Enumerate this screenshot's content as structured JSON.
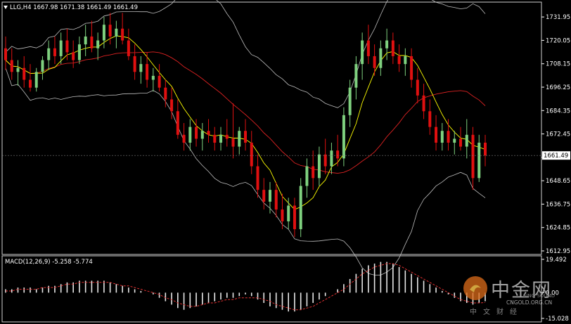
{
  "window": {
    "symbol": "LLG,H4",
    "open": "1667.98",
    "high": "1671.38",
    "low": "1661.49",
    "close": "1661.49"
  },
  "price_axis": {
    "ticks": [
      "1731.95",
      "1720.05",
      "1708.15",
      "1696.25",
      "1684.35",
      "1672.45",
      "1660.55",
      "1648.65",
      "1636.75",
      "1624.85",
      "1612.95"
    ],
    "current_price": "1661.49"
  },
  "macd": {
    "label": "MACD(12,26,9)",
    "macd_value": "-5.258",
    "signal_value": "-5.774",
    "axis_top": "19.492",
    "axis_zero": "0.00",
    "axis_bottom": "-15.028"
  },
  "watermark": {
    "brand": "中金网",
    "url": "CNGOLD.ORG.CN",
    "tagline": "中文财经",
    "sub": "SINO SOUND"
  },
  "colors": {
    "background": "#000000",
    "bull": "#7fd17f",
    "bear": "#e01010",
    "ma": "#ffff00",
    "bands": "#bdbdbd",
    "signal": "#e03030",
    "histogram": "#e8e8e8"
  },
  "chart_data": {
    "type": "candlestick",
    "title": "",
    "ylim": [
      1612.95,
      1737.0
    ],
    "candles": [
      {
        "o": 1716,
        "h": 1722,
        "l": 1705,
        "c": 1710
      },
      {
        "o": 1710,
        "h": 1716,
        "l": 1700,
        "c": 1704
      },
      {
        "o": 1704,
        "h": 1710,
        "l": 1697,
        "c": 1706
      },
      {
        "o": 1706,
        "h": 1712,
        "l": 1696,
        "c": 1700
      },
      {
        "o": 1700,
        "h": 1708,
        "l": 1694,
        "c": 1696
      },
      {
        "o": 1696,
        "h": 1706,
        "l": 1694,
        "c": 1704
      },
      {
        "o": 1704,
        "h": 1712,
        "l": 1700,
        "c": 1710
      },
      {
        "o": 1710,
        "h": 1720,
        "l": 1705,
        "c": 1716
      },
      {
        "o": 1716,
        "h": 1722,
        "l": 1708,
        "c": 1712
      },
      {
        "o": 1712,
        "h": 1724,
        "l": 1708,
        "c": 1720
      },
      {
        "o": 1720,
        "h": 1726,
        "l": 1710,
        "c": 1714
      },
      {
        "o": 1714,
        "h": 1720,
        "l": 1706,
        "c": 1710
      },
      {
        "o": 1710,
        "h": 1722,
        "l": 1708,
        "c": 1718
      },
      {
        "o": 1718,
        "h": 1728,
        "l": 1712,
        "c": 1722
      },
      {
        "o": 1722,
        "h": 1730,
        "l": 1714,
        "c": 1716
      },
      {
        "o": 1716,
        "h": 1724,
        "l": 1710,
        "c": 1720
      },
      {
        "o": 1720,
        "h": 1732,
        "l": 1716,
        "c": 1728
      },
      {
        "o": 1728,
        "h": 1734,
        "l": 1718,
        "c": 1722
      },
      {
        "o": 1722,
        "h": 1730,
        "l": 1716,
        "c": 1726
      },
      {
        "o": 1726,
        "h": 1734,
        "l": 1718,
        "c": 1720
      },
      {
        "o": 1720,
        "h": 1726,
        "l": 1710,
        "c": 1712
      },
      {
        "o": 1712,
        "h": 1718,
        "l": 1700,
        "c": 1704
      },
      {
        "o": 1704,
        "h": 1712,
        "l": 1698,
        "c": 1708
      },
      {
        "o": 1708,
        "h": 1714,
        "l": 1696,
        "c": 1700
      },
      {
        "o": 1700,
        "h": 1706,
        "l": 1694,
        "c": 1702
      },
      {
        "o": 1702,
        "h": 1708,
        "l": 1694,
        "c": 1696
      },
      {
        "o": 1696,
        "h": 1700,
        "l": 1686,
        "c": 1690
      },
      {
        "o": 1690,
        "h": 1696,
        "l": 1680,
        "c": 1684
      },
      {
        "o": 1684,
        "h": 1690,
        "l": 1670,
        "c": 1672
      },
      {
        "o": 1672,
        "h": 1678,
        "l": 1664,
        "c": 1668
      },
      {
        "o": 1668,
        "h": 1680,
        "l": 1664,
        "c": 1676
      },
      {
        "o": 1676,
        "h": 1680,
        "l": 1666,
        "c": 1670
      },
      {
        "o": 1670,
        "h": 1678,
        "l": 1664,
        "c": 1674
      },
      {
        "o": 1674,
        "h": 1680,
        "l": 1668,
        "c": 1672
      },
      {
        "o": 1672,
        "h": 1676,
        "l": 1664,
        "c": 1668
      },
      {
        "o": 1668,
        "h": 1676,
        "l": 1664,
        "c": 1672
      },
      {
        "o": 1672,
        "h": 1680,
        "l": 1666,
        "c": 1670
      },
      {
        "o": 1670,
        "h": 1688,
        "l": 1660,
        "c": 1666
      },
      {
        "o": 1666,
        "h": 1676,
        "l": 1662,
        "c": 1674
      },
      {
        "o": 1674,
        "h": 1680,
        "l": 1664,
        "c": 1668
      },
      {
        "o": 1668,
        "h": 1674,
        "l": 1652,
        "c": 1656
      },
      {
        "o": 1656,
        "h": 1662,
        "l": 1640,
        "c": 1644
      },
      {
        "o": 1644,
        "h": 1650,
        "l": 1634,
        "c": 1638
      },
      {
        "o": 1638,
        "h": 1648,
        "l": 1632,
        "c": 1644
      },
      {
        "o": 1644,
        "h": 1648,
        "l": 1630,
        "c": 1634
      },
      {
        "o": 1634,
        "h": 1642,
        "l": 1624,
        "c": 1628
      },
      {
        "o": 1628,
        "h": 1640,
        "l": 1624,
        "c": 1636
      },
      {
        "o": 1636,
        "h": 1640,
        "l": 1620,
        "c": 1624
      },
      {
        "o": 1624,
        "h": 1650,
        "l": 1620,
        "c": 1646
      },
      {
        "o": 1646,
        "h": 1660,
        "l": 1640,
        "c": 1656
      },
      {
        "o": 1656,
        "h": 1664,
        "l": 1644,
        "c": 1650
      },
      {
        "o": 1650,
        "h": 1666,
        "l": 1646,
        "c": 1662
      },
      {
        "o": 1662,
        "h": 1670,
        "l": 1652,
        "c": 1656
      },
      {
        "o": 1656,
        "h": 1668,
        "l": 1652,
        "c": 1664
      },
      {
        "o": 1664,
        "h": 1672,
        "l": 1656,
        "c": 1660
      },
      {
        "o": 1660,
        "h": 1686,
        "l": 1656,
        "c": 1682
      },
      {
        "o": 1682,
        "h": 1700,
        "l": 1676,
        "c": 1696
      },
      {
        "o": 1696,
        "h": 1712,
        "l": 1690,
        "c": 1708
      },
      {
        "o": 1708,
        "h": 1724,
        "l": 1700,
        "c": 1720
      },
      {
        "o": 1720,
        "h": 1728,
        "l": 1708,
        "c": 1712
      },
      {
        "o": 1712,
        "h": 1718,
        "l": 1702,
        "c": 1706
      },
      {
        "o": 1706,
        "h": 1720,
        "l": 1702,
        "c": 1716
      },
      {
        "o": 1716,
        "h": 1726,
        "l": 1710,
        "c": 1720
      },
      {
        "o": 1720,
        "h": 1724,
        "l": 1708,
        "c": 1712
      },
      {
        "o": 1712,
        "h": 1718,
        "l": 1704,
        "c": 1708
      },
      {
        "o": 1708,
        "h": 1716,
        "l": 1702,
        "c": 1712
      },
      {
        "o": 1712,
        "h": 1716,
        "l": 1696,
        "c": 1700
      },
      {
        "o": 1700,
        "h": 1706,
        "l": 1688,
        "c": 1692
      },
      {
        "o": 1692,
        "h": 1698,
        "l": 1680,
        "c": 1684
      },
      {
        "o": 1684,
        "h": 1690,
        "l": 1672,
        "c": 1676
      },
      {
        "o": 1676,
        "h": 1682,
        "l": 1664,
        "c": 1668
      },
      {
        "o": 1668,
        "h": 1678,
        "l": 1664,
        "c": 1674
      },
      {
        "o": 1674,
        "h": 1680,
        "l": 1664,
        "c": 1668
      },
      {
        "o": 1668,
        "h": 1674,
        "l": 1662,
        "c": 1670
      },
      {
        "o": 1670,
        "h": 1676,
        "l": 1664,
        "c": 1666
      },
      {
        "o": 1666,
        "h": 1680,
        "l": 1660,
        "c": 1672
      },
      {
        "o": 1672,
        "h": 1676,
        "l": 1644,
        "c": 1650
      },
      {
        "o": 1650,
        "h": 1672,
        "l": 1648,
        "c": 1668
      },
      {
        "o": 1668,
        "h": 1672,
        "l": 1656,
        "c": 1661.49
      }
    ],
    "macd_histogram": [
      2,
      2,
      3,
      3,
      3,
      2,
      3,
      4,
      4,
      5,
      6,
      6,
      7,
      7,
      7,
      7,
      7,
      6,
      5,
      4,
      3,
      2,
      1,
      0,
      -1,
      -3,
      -5,
      -7,
      -9,
      -10,
      -9,
      -8,
      -7,
      -6,
      -5,
      -4,
      -3,
      -3,
      -2,
      -1,
      -2,
      -4,
      -6,
      -8,
      -9,
      -10,
      -11,
      -11,
      -10,
      -8,
      -6,
      -4,
      -2,
      0,
      2,
      5,
      8,
      11,
      14,
      16,
      17,
      18,
      18,
      17,
      15,
      13,
      11,
      9,
      7,
      5,
      3,
      1,
      -1,
      -3,
      -5,
      -6,
      -7,
      -6,
      -5
    ],
    "macd_signal": [
      1,
      1,
      2,
      2,
      2,
      2,
      3,
      3,
      3,
      4,
      5,
      5,
      6,
      6,
      6,
      6,
      6,
      6,
      5,
      4,
      4,
      3,
      2,
      1,
      0,
      -1,
      -3,
      -4,
      -6,
      -7,
      -8,
      -8,
      -7,
      -6,
      -6,
      -5,
      -4,
      -4,
      -3,
      -3,
      -3,
      -3,
      -4,
      -5,
      -7,
      -8,
      -9,
      -10,
      -10,
      -9,
      -8,
      -6,
      -4,
      -2,
      0,
      2,
      5,
      8,
      11,
      13,
      15,
      16,
      17,
      17,
      16,
      14,
      12,
      10,
      8,
      6,
      4,
      2,
      0,
      -2,
      -4,
      -5,
      -6,
      -6,
      -5.774
    ]
  }
}
